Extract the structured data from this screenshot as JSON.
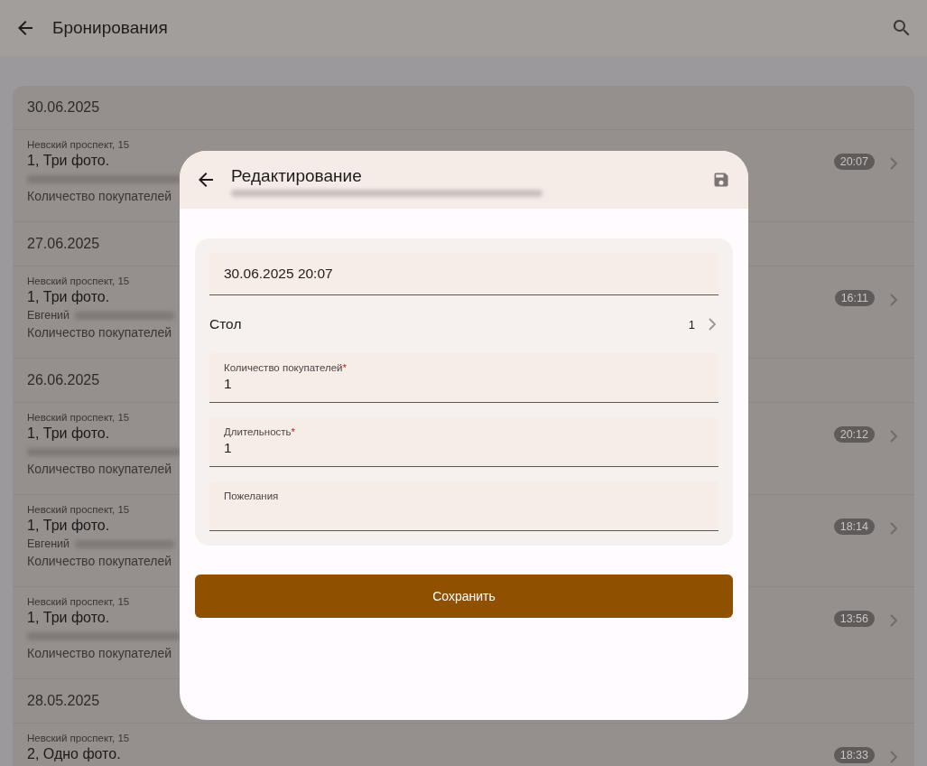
{
  "app_bar": {
    "title": "Бронирования"
  },
  "groups": [
    {
      "date": "30.06.2025",
      "bookings": [
        {
          "address": "Невский проспект, 15",
          "title": "1, Три фото.",
          "contact_hidden": true,
          "guests": "Количество покупателей",
          "time": "20:07"
        }
      ]
    },
    {
      "date": "27.06.2025",
      "bookings": [
        {
          "address": "Невский проспект, 15",
          "title": "1, Три фото.",
          "contact": "Евгений",
          "contact_hidden": true,
          "guests": "Количество покупателей",
          "time": "16:11"
        }
      ]
    },
    {
      "date": "26.06.2025",
      "bookings": [
        {
          "address": "Невский проспект, 15",
          "title": "1, Три фото.",
          "contact_hidden": true,
          "guests": "Количество покупателей",
          "time": "20:12"
        },
        {
          "address": "Невский проспект, 15",
          "title": "1, Три фото.",
          "contact": "Евгений",
          "contact_hidden": true,
          "guests": "Количество покупателей",
          "time": "18:14"
        },
        {
          "address": "Невский проспект, 15",
          "title": "1, Три фото.",
          "contact_hidden": true,
          "guests": "Количество покупателей",
          "time": "13:56"
        }
      ]
    },
    {
      "date": "28.05.2025",
      "bookings": [
        {
          "address": "Невский проспект, 15",
          "title": "2, Одно фото.",
          "time": "18:33"
        }
      ]
    }
  ],
  "dialog": {
    "title": "Редактирование",
    "fields": [
      {
        "kind": "date",
        "value": "30.06.2025 20:07"
      },
      {
        "kind": "picker",
        "label": "Стол",
        "value": "1"
      },
      {
        "kind": "text",
        "label": "Количество покупателей",
        "required_mark": "*",
        "value": "1"
      },
      {
        "kind": "text",
        "label": "Длительность",
        "required_mark": "*",
        "value": "1"
      },
      {
        "kind": "text",
        "label": "Пожелания"
      }
    ],
    "save_button": "Сохранить"
  }
}
